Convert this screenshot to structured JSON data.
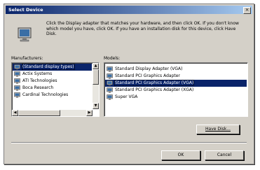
{
  "window": {
    "title": "Select Device",
    "close_symbol": "×"
  },
  "instructions": "Click the Display adapter that matches your hardware, and then click OK. If you don't know which model you have, click OK. If you have an installation disk for this device, click Have Disk.",
  "manufacturers": {
    "label": "Manufacturers:",
    "items": [
      "(Standard display types)",
      "Actix Systems",
      "ATI Technologies",
      "Boca Research",
      "Cardinal Technologies"
    ],
    "selected_index": 0
  },
  "models": {
    "label": "Models:",
    "items": [
      "Standard Display Adapter (VGA)",
      "Standard PCI Graphics Adapter",
      "Standard PCI Graphics Adapter (VGA)",
      "Standard PCI Graphics Adapter (XGA)",
      "Super VGA"
    ],
    "selected_index": 2
  },
  "buttons": {
    "have_disk": "Have Disk...",
    "ok": "OK",
    "cancel": "Cancel"
  },
  "colors": {
    "title_bar": "#0a246a",
    "dialog_bg": "#d4d0c8",
    "selection": "#0a246a"
  },
  "icons": {
    "header": "monitor-icon",
    "list_item": "display-adapter-icon"
  }
}
